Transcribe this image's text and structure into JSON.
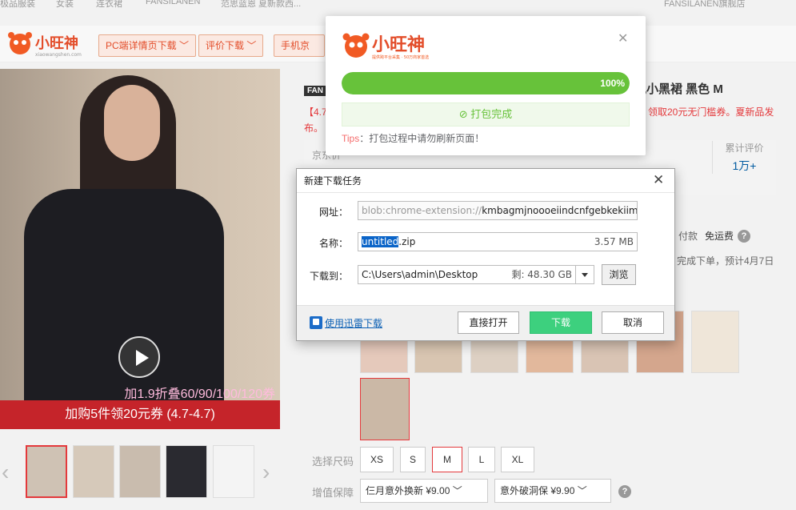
{
  "breadcrumb": {
    "items": [
      "极品服装",
      "女装",
      "连衣裙",
      "FANSILANEN",
      "范思蓝恩 夏新款西..."
    ],
    "shop": "FANSILANEN旗舰店"
  },
  "plugin": {
    "brand": "小旺神",
    "brand_url": "xiaowangshen.com",
    "buttons": [
      "PC端详情页下载 ﹀",
      "评价下载 ﹀",
      "手机京东"
    ]
  },
  "gallery": {
    "promo_top": "加1.9折叠60/90/100/120券",
    "promo_bottom": "加购5件领20元券 (4.7-4.7)"
  },
  "product": {
    "title_tail": "本风小黑裙 黑色 M",
    "promo_prefix": "【4.7",
    "promo_right": "领取20元无门槛券。夏新品发",
    "promo_line2": "布。",
    "price_label": "京东价",
    "rating_label": "累计评价",
    "rating_value": "1万+",
    "pay_text": "付款",
    "free_ship": "免运费",
    "ship_text": "完成下单，预计4月7日",
    "size_label": "选择尺码",
    "sizes": [
      "XS",
      "S",
      "M",
      "L",
      "XL"
    ],
    "selected_size": "M",
    "service_label": "增值保障",
    "services": [
      "仨月意外换新 ¥9.00 ﹀",
      "意外破洞保 ¥9.90 ﹀"
    ]
  },
  "pack_modal": {
    "brand": "小旺神",
    "subtitle": "提供跨平台采集 · 50万商家首选",
    "progress_text": "100%",
    "progress_value": 100,
    "done_text": "打包完成",
    "tips_key": "Tips",
    "tips_text": "：打包过程中请勿刷新页面！"
  },
  "download_dialog": {
    "title": "新建下载任务",
    "url_label": "网址：",
    "url_prefix": "blob:chrome-extension://",
    "url_rest": "kmbagmjnoooeiindcnfgebkekiim",
    "name_label": "名称：",
    "name_selected": "untitled",
    "name_ext": ".zip",
    "size": "3.57 MB",
    "path_label": "下载到：",
    "path_value": "C:\\Users\\admin\\Desktop",
    "free_space": "剩: 48.30 GB",
    "browse_label": "浏览",
    "thunder_link": "使用迅雷下载",
    "open_label": "直接打开",
    "download_label": "下载",
    "cancel_label": "取消"
  },
  "colors": {
    "jd_red": "#e4393c",
    "progress_green": "#67c23a",
    "download_green": "#3dd07e",
    "link_blue": "#0a5fb4"
  }
}
